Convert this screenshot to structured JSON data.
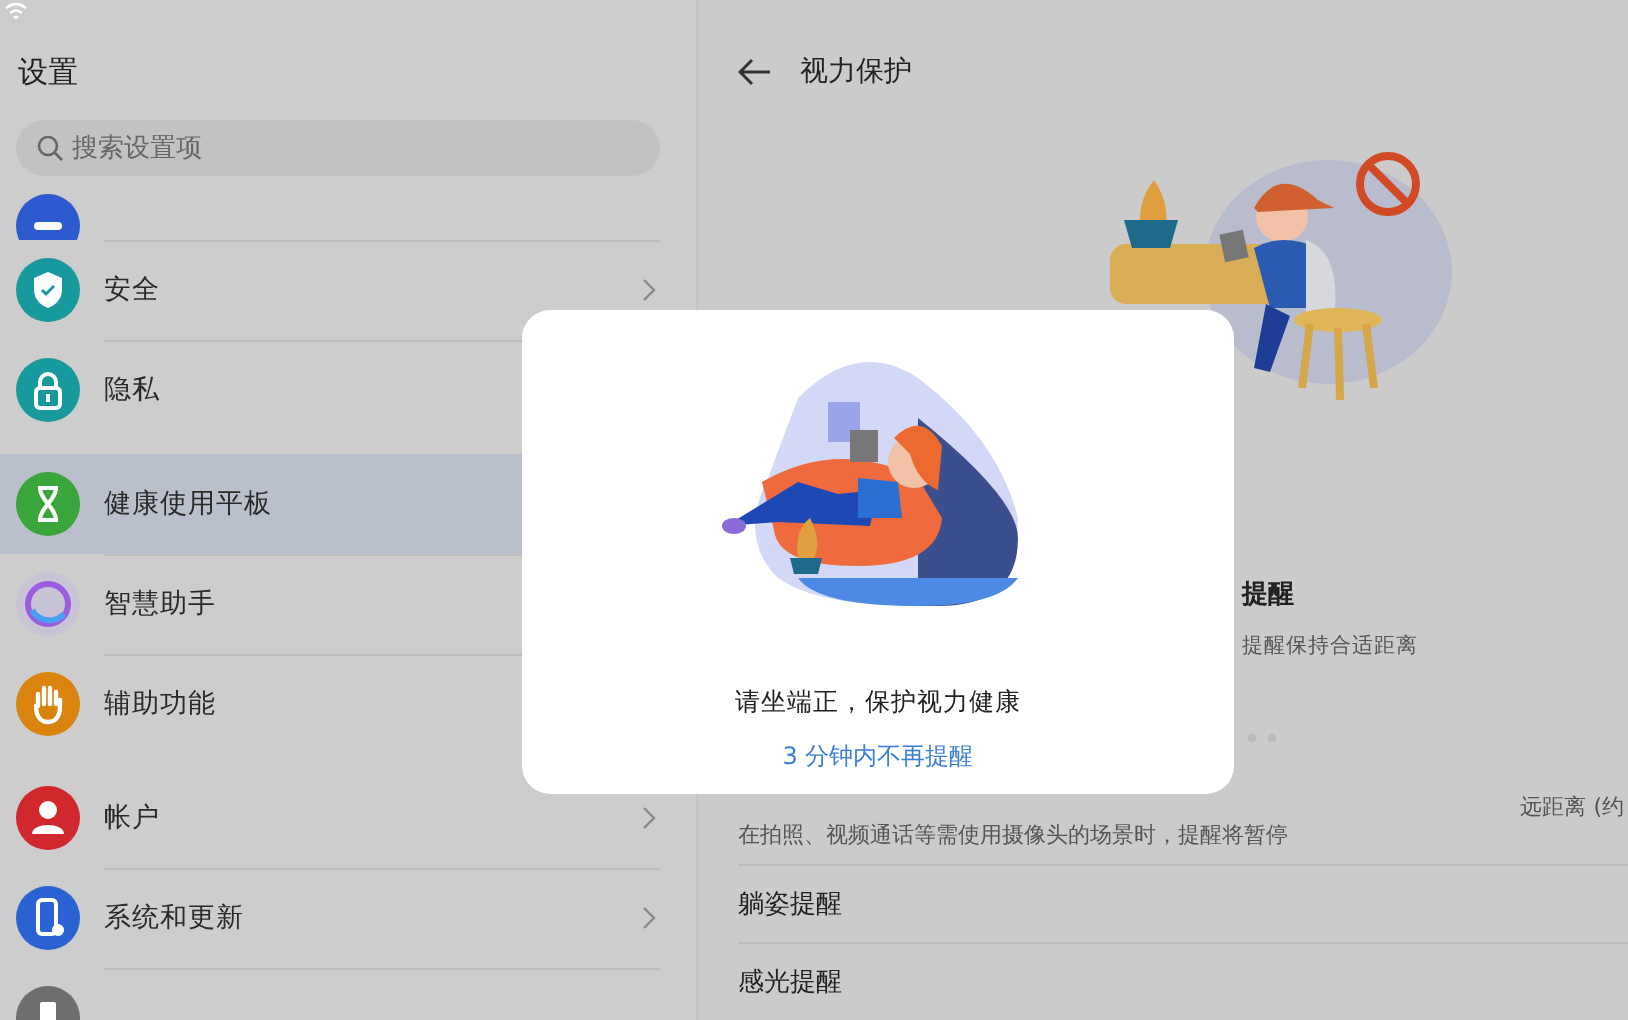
{
  "sidebar": {
    "title": "设置",
    "search": {
      "placeholder": "搜索设置项"
    },
    "groups": [
      [
        {
          "kind": "partial",
          "color": "#2d5ad0",
          "selected": false
        },
        {
          "kind": "row",
          "label": "安全",
          "color": "#17999d",
          "selected": false
        },
        {
          "kind": "row",
          "label": "隐私",
          "color": "#17999d",
          "selected": false
        }
      ],
      [
        {
          "kind": "row",
          "label": "健康使用平板",
          "color": "#3aa53a",
          "selected": true
        },
        {
          "kind": "row",
          "label": "智慧助手",
          "color": "#c9c3d6",
          "selected": false
        },
        {
          "kind": "row",
          "label": "辅助功能",
          "color": "#d9840e",
          "selected": false
        }
      ],
      [
        {
          "kind": "row",
          "label": "帐户",
          "color": "#d0282c",
          "selected": false
        },
        {
          "kind": "row",
          "label": "系统和更新",
          "color": "#2a62d4",
          "selected": false
        },
        {
          "kind": "partial",
          "color": "#6e6e6e",
          "selected": false
        }
      ]
    ]
  },
  "detail": {
    "title": "视力保护",
    "section_title": "提醒",
    "section_subtitle": "提醒保持合适距离",
    "distance_label": "远距离 (约",
    "note": "在拍照、视频通话等需使用摄像头的场景时，提醒将暂停",
    "items": [
      {
        "label": "躺姿提醒"
      },
      {
        "label": "感光提醒"
      }
    ]
  },
  "dialog": {
    "message": "请坐端正，保护视力健康",
    "action": "3 分钟内不再提醒"
  }
}
